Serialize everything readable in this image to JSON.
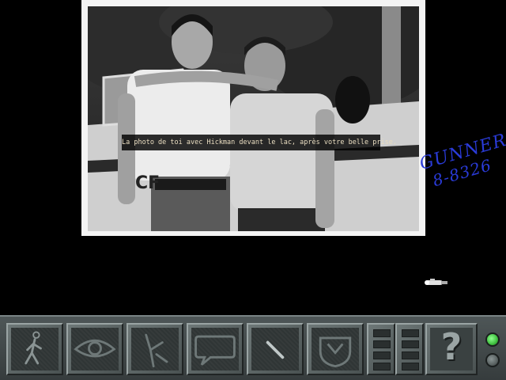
{
  "scene": {
    "photo_caption": "La photo de toi avec Hickman devant le lac, après votre belle prise.",
    "photo_inscription_line1": "GUNNER",
    "photo_inscription_line2": "8-8326",
    "inscription_color": "#2a3bd8"
  },
  "toolbar": {
    "buttons": [
      {
        "name": "walk",
        "icon": "walking-man-icon"
      },
      {
        "name": "look",
        "icon": "eye-icon"
      },
      {
        "name": "use",
        "icon": "hand-icon"
      },
      {
        "name": "talk",
        "icon": "speech-bubble-icon"
      },
      {
        "name": "item",
        "icon": "inventory-item-icon"
      },
      {
        "name": "inventory",
        "icon": "bag-icon"
      }
    ],
    "help_label": "?",
    "status_lights": [
      {
        "name": "upper",
        "color": "#3fbf3f",
        "lit": true
      },
      {
        "name": "lower",
        "color": "#5a6262",
        "lit": false
      }
    ]
  }
}
